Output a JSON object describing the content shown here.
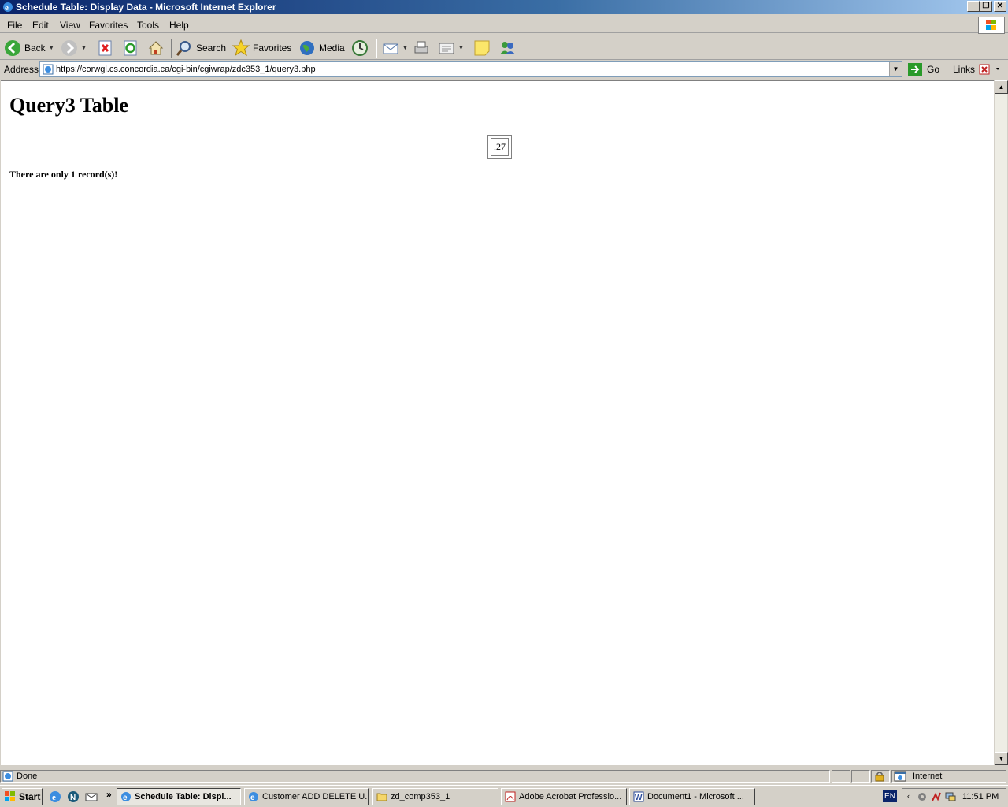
{
  "window": {
    "title": "Schedule Table: Display Data - Microsoft Internet Explorer",
    "controls": {
      "minimize": "_",
      "restore": "❐",
      "close": "✕"
    }
  },
  "menu": [
    "File",
    "Edit",
    "View",
    "Favorites",
    "Tools",
    "Help"
  ],
  "toolbar": {
    "back": "Back",
    "search": "Search",
    "favorites": "Favorites",
    "media": "Media"
  },
  "address": {
    "label": "Address",
    "url": "https://corwgl.cs.concordia.ca/cgi-bin/cgiwrap/zdc353_1/query3.php",
    "go": "Go",
    "links": "Links"
  },
  "page": {
    "heading": "Query3 Table",
    "table_rows": [
      [
        ".27"
      ]
    ],
    "record_message": "There are only 1 record(s)!"
  },
  "status": {
    "text": "Done",
    "zone": "Internet"
  },
  "taskbar": {
    "start": "Start",
    "more": "»",
    "tasks": [
      {
        "label": "Schedule Table: Displ...",
        "active": true,
        "icon": "ie-icon"
      },
      {
        "label": "Customer ADD DELETE U...",
        "active": false,
        "icon": "ie-icon"
      },
      {
        "label": "zd_comp353_1",
        "active": false,
        "icon": "folder-icon"
      },
      {
        "label": "Adobe Acrobat Professio...",
        "active": false,
        "icon": "acrobat-icon"
      },
      {
        "label": "Document1 - Microsoft ...",
        "active": false,
        "icon": "word-icon"
      }
    ],
    "lang": "EN",
    "clock": "11:51 PM"
  },
  "colors": {
    "titlebar_start": "#0a246a",
    "titlebar_end": "#a6caf0",
    "chrome": "#d4d0c8"
  }
}
